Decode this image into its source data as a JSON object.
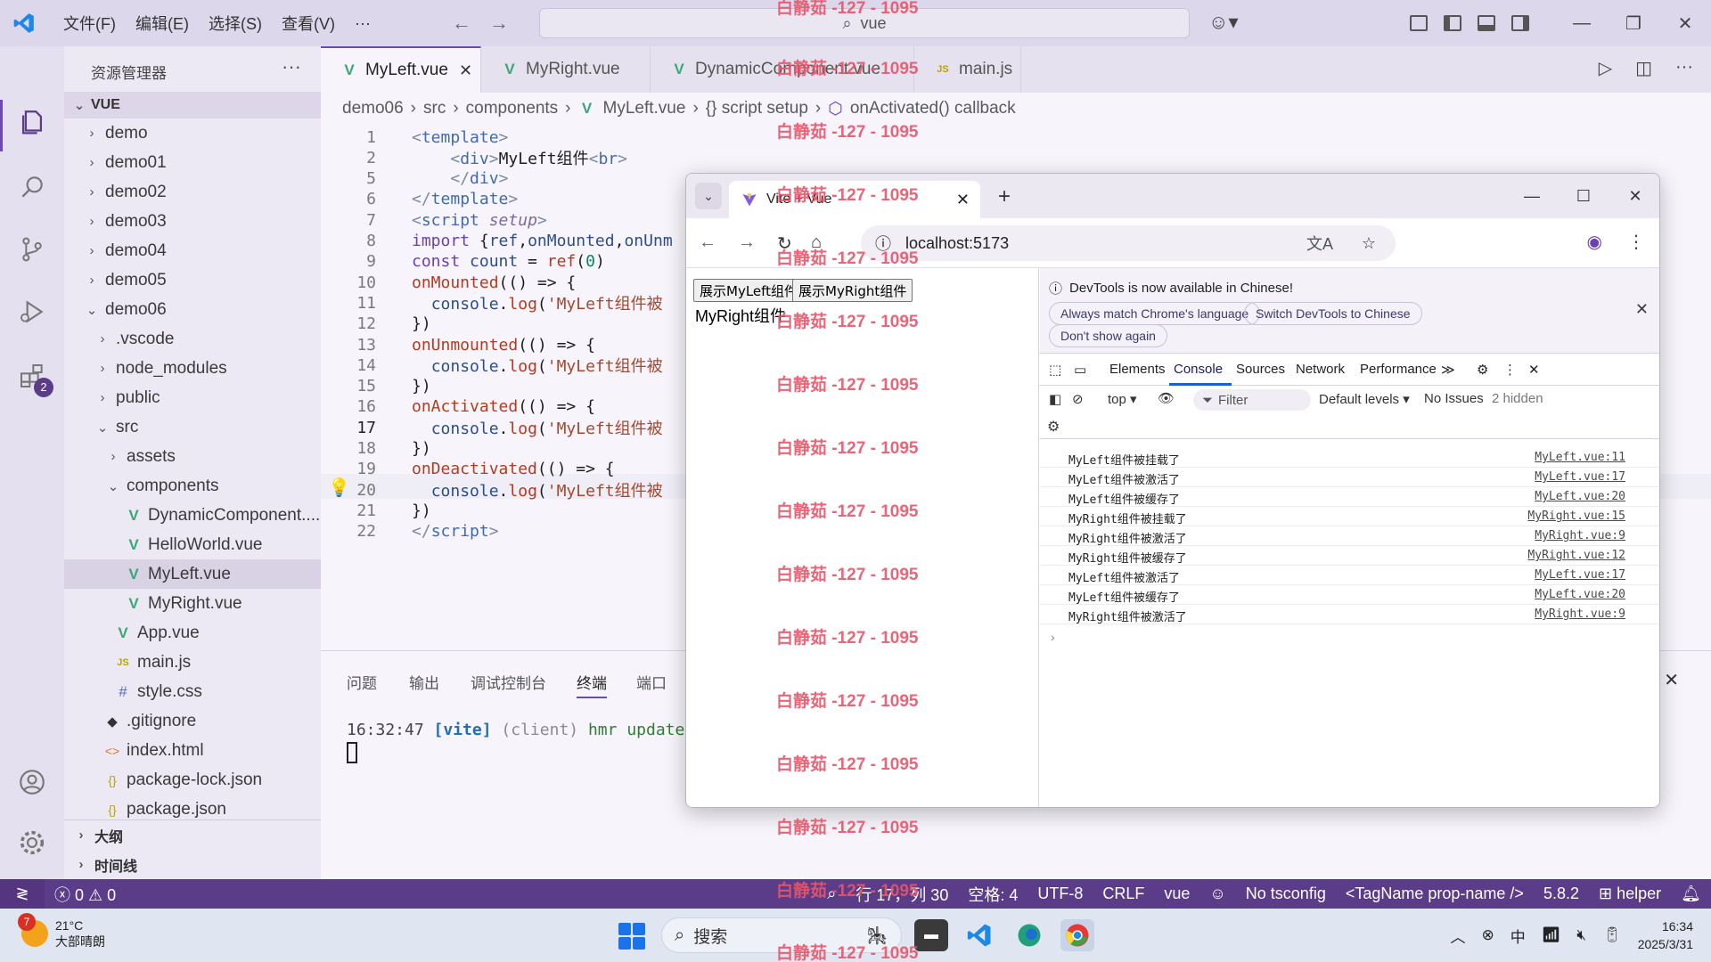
{
  "titlebar": {
    "menus": [
      "文件(F)",
      "编辑(E)",
      "选择(S)",
      "查看(V)",
      "···"
    ],
    "search_text": "vue"
  },
  "sidebar": {
    "title": "资源管理器",
    "more": "···",
    "folder": "VUE",
    "tree": [
      {
        "label": "demo",
        "type": "folder",
        "open": false
      },
      {
        "label": "demo01",
        "type": "folder",
        "open": false
      },
      {
        "label": "demo02",
        "type": "folder",
        "open": false
      },
      {
        "label": "demo03",
        "type": "folder",
        "open": false
      },
      {
        "label": "demo04",
        "type": "folder",
        "open": false
      },
      {
        "label": "demo05",
        "type": "folder",
        "open": false
      },
      {
        "label": "demo06",
        "type": "folder",
        "open": true
      },
      {
        "label": ".vscode",
        "type": "folder",
        "open": false
      },
      {
        "label": "node_modules",
        "type": "folder",
        "open": false
      },
      {
        "label": "public",
        "type": "folder",
        "open": false
      },
      {
        "label": "src",
        "type": "folder",
        "open": true
      },
      {
        "label": "assets",
        "type": "folder",
        "open": false
      },
      {
        "label": "components",
        "type": "folder",
        "open": true
      },
      {
        "label": "DynamicComponent....",
        "type": "vue"
      },
      {
        "label": "HelloWorld.vue",
        "type": "vue"
      },
      {
        "label": "MyLeft.vue",
        "type": "vue",
        "selected": true
      },
      {
        "label": "MyRight.vue",
        "type": "vue"
      },
      {
        "label": "App.vue",
        "type": "vue"
      },
      {
        "label": "main.js",
        "type": "js"
      },
      {
        "label": "style.css",
        "type": "css"
      },
      {
        "label": ".gitignore",
        "type": "git"
      },
      {
        "label": "index.html",
        "type": "html"
      },
      {
        "label": "package-lock.json",
        "type": "json"
      },
      {
        "label": "package.json",
        "type": "json"
      }
    ],
    "sections": [
      "大纲",
      "时间线"
    ]
  },
  "activitybar": {
    "extensions_badge": "2"
  },
  "tabs": [
    {
      "label": "MyLeft.vue",
      "icon": "vue",
      "active": true
    },
    {
      "label": "MyRight.vue",
      "icon": "vue"
    },
    {
      "label": "DynamicComponent.vue",
      "icon": "vue"
    },
    {
      "label": "main.js",
      "icon": "js"
    }
  ],
  "breadcrumb": [
    "demo06",
    "src",
    "components",
    "MyLeft.vue",
    "{} script setup",
    "onActivated() callback"
  ],
  "code_lines": [
    {
      "n": "1",
      "html": "<span class='t-punc'>&lt;</span><span class='t-tag'>template</span><span class='t-punc'>&gt;</span>"
    },
    {
      "n": "2",
      "html": "    <span class='t-punc'>&lt;</span><span class='t-tag'>div</span><span class='t-punc'>&gt;</span>MyLeft组件<span class='t-punc'>&lt;</span><span class='t-tag'>br</span><span class='t-punc'>&gt;</span>"
    },
    {
      "n": "5",
      "html": "    <span class='t-punc'>&lt;/</span><span class='t-tag'>div</span><span class='t-punc'>&gt;</span>"
    },
    {
      "n": "6",
      "html": "<span class='t-punc'>&lt;/</span><span class='t-tag'>template</span><span class='t-punc'>&gt;</span>"
    },
    {
      "n": "7",
      "html": "<span class='t-punc'>&lt;</span><span class='t-tag'>script</span> <span class='t-attr'>setup</span><span class='t-punc'>&gt;</span>"
    },
    {
      "n": "8",
      "html": "<span class='t-kw'>import</span> {<span class='t-var'>ref</span>,<span class='t-var'>onMounted</span>,<span class='t-var'>onUnm</span>"
    },
    {
      "n": "9",
      "html": "<span class='t-kw'>const</span> <span class='t-var'>count</span> = <span class='t-fn'>ref</span>(<span class='t-num'>0</span>)"
    },
    {
      "n": "10",
      "html": "<span class='t-fn'>onMounted</span>(() =&gt; {"
    },
    {
      "n": "11",
      "html": "  <span class='t-var'>console</span>.<span class='t-fn'>log</span>(<span class='t-str'>'MyLeft组件被</span>"
    },
    {
      "n": "12",
      "html": "})"
    },
    {
      "n": "13",
      "html": "<span class='t-fn'>onUnmounted</span>(() =&gt; {"
    },
    {
      "n": "14",
      "html": "  <span class='t-var'>console</span>.<span class='t-fn'>log</span>(<span class='t-str'>'MyLeft组件被</span>"
    },
    {
      "n": "15",
      "html": "})"
    },
    {
      "n": "16",
      "html": "<span class='t-fn'>onActivated</span>(() =&gt; {"
    },
    {
      "n": "17",
      "html": "  <span class='t-var'>console</span>.<span class='t-fn'>log</span>(<span class='t-str'>'MyLeft组件被</span>"
    },
    {
      "n": "18",
      "html": "})"
    },
    {
      "n": "19",
      "html": "<span class='t-fn'>onDeactivated</span>(() =&gt; {"
    },
    {
      "n": "20",
      "html": "  <span class='t-var'>console</span>.<span class='t-fn'>log</span>(<span class='t-str'>'MyLeft组件被</span>"
    },
    {
      "n": "21",
      "html": "})"
    },
    {
      "n": "22",
      "html": "<span class='t-punc'>&lt;/</span><span class='t-tag'>script</span><span class='t-punc'>&gt;</span>"
    }
  ],
  "panel": {
    "tabs": [
      "问题",
      "输出",
      "调试控制台",
      "终端",
      "端口"
    ],
    "active_tab": "终端",
    "terminal_time": "16:32:47",
    "terminal_tag": "[vite]",
    "terminal_client": "(client)",
    "terminal_msg": "hmr update"
  },
  "statusbar": {
    "errors": "0",
    "warnings": "0",
    "position": "行 17，列 30",
    "spaces": "空格: 4",
    "encoding": "UTF-8",
    "eol": "CRLF",
    "language": "vue",
    "tsconfig": "No tsconfig",
    "tagname": "<TagName prop-name />",
    "version": "5.8.2",
    "helper": "helper"
  },
  "taskbar": {
    "weather_badge": "7",
    "temperature": "21°C",
    "weather": "大部晴朗",
    "search": "搜索",
    "ime": "中",
    "time": "16:34",
    "date": "2025/3/31"
  },
  "chrome": {
    "tab_title": "Vite + Vue",
    "url": "localhost:5173",
    "page": {
      "buttons": [
        "展示MyLeft组件",
        "展示MyRight组件"
      ],
      "content": "MyRight组件"
    },
    "devtools": {
      "notice": "DevTools is now available in Chinese!",
      "pills": [
        "Always match Chrome's language",
        "Switch DevTools to Chinese",
        "Don't show again"
      ],
      "tabs": [
        "Elements",
        "Console",
        "Sources",
        "Network",
        "Performance"
      ],
      "active_tab": "Console",
      "context": "top",
      "filter": "Filter",
      "levels": "Default levels",
      "issues": "No Issues",
      "hidden": "2 hidden",
      "logs": [
        {
          "msg": "MyLeft组件被挂载了",
          "src": "MyLeft.vue:11"
        },
        {
          "msg": "MyLeft组件被激活了",
          "src": "MyLeft.vue:17"
        },
        {
          "msg": "MyLeft组件被缓存了",
          "src": "MyLeft.vue:20"
        },
        {
          "msg": "MyRight组件被挂载了",
          "src": "MyRight.vue:15"
        },
        {
          "msg": "MyRight组件被激活了",
          "src": "MyRight.vue:9"
        },
        {
          "msg": "MyRight组件被缓存了",
          "src": "MyRight.vue:12"
        },
        {
          "msg": "MyLeft组件被激活了",
          "src": "MyLeft.vue:17"
        },
        {
          "msg": "MyLeft组件被缓存了",
          "src": "MyLeft.vue:20"
        },
        {
          "msg": "MyRight组件被激活了",
          "src": "MyRight.vue:9"
        }
      ]
    }
  },
  "watermark": "白静茹 -127 - 1095",
  "colors": {
    "accent": "#6c4ab6",
    "statusbar": "#5b3c88",
    "watermark": "#e8556a"
  }
}
